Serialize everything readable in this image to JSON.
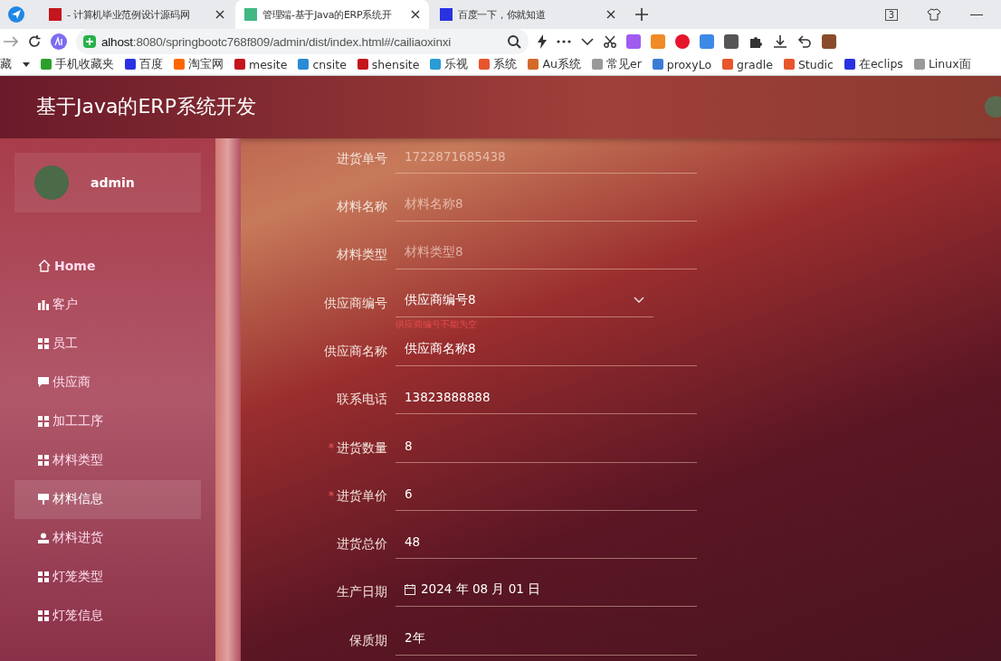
{
  "browser": {
    "tabs": [
      {
        "title": "- 计算机毕业范例设计源码网",
        "selected": false
      },
      {
        "title": "管理端-基于Java的ERP系统开",
        "selected": true
      },
      {
        "title": "百度一下，你就知道",
        "selected": false
      }
    ],
    "tab_count": "3",
    "address": {
      "host": "alhost",
      "rest": ":8080/springbootc768f809/admin/dist/index.html#/cailiaoxinxi"
    },
    "bookmarks_lead": "藏",
    "bookmarks": [
      "手机收藏夹",
      "百度",
      "淘宝网",
      "mesite",
      "cnsite",
      "shensite",
      "乐视",
      "系统",
      "Au系统",
      "常见er",
      "proxyLo",
      "gradle",
      "Studic",
      "在eclips",
      "Linux面"
    ]
  },
  "app": {
    "title": "基于Java的ERP系统开发",
    "user": {
      "name": "admin"
    },
    "menu": [
      {
        "label": "Home",
        "kind": "home",
        "selected": false
      },
      {
        "label": "客户",
        "kind": "chart",
        "selected": false
      },
      {
        "label": "员工",
        "kind": "grid",
        "selected": false
      },
      {
        "label": "供应商",
        "kind": "chat",
        "selected": false
      },
      {
        "label": "加工工序",
        "kind": "grid",
        "selected": false
      },
      {
        "label": "材料类型",
        "kind": "grid",
        "selected": false
      },
      {
        "label": "材料信息",
        "kind": "pin",
        "selected": true
      },
      {
        "label": "材料进货",
        "kind": "person",
        "selected": false
      },
      {
        "label": "灯笼类型",
        "kind": "grid",
        "selected": false
      },
      {
        "label": "灯笼信息",
        "kind": "grid",
        "selected": false
      }
    ],
    "form": [
      {
        "label": "进货单号",
        "value": "1722871685438",
        "kind": "input",
        "disabled": true,
        "required": false
      },
      {
        "label": "材料名称",
        "value": "材料名称8",
        "kind": "input",
        "disabled": true,
        "required": false
      },
      {
        "label": "材料类型",
        "value": "材料类型8",
        "kind": "input",
        "disabled": true,
        "required": false
      },
      {
        "label": "供应商编号",
        "value": "供应商编号8",
        "kind": "select",
        "disabled": false,
        "required": false,
        "error": "供应商编号不能为空"
      },
      {
        "label": "供应商名称",
        "value": "供应商名称8",
        "kind": "input",
        "disabled": false,
        "required": false
      },
      {
        "label": "联系电话",
        "value": "13823888888",
        "kind": "input",
        "disabled": false,
        "required": false
      },
      {
        "label": "进货数量",
        "value": "8",
        "kind": "input",
        "disabled": false,
        "required": true
      },
      {
        "label": "进货单价",
        "value": "6",
        "kind": "input",
        "disabled": false,
        "required": true
      },
      {
        "label": "进货总价",
        "value": "48",
        "kind": "input",
        "disabled": false,
        "required": false
      },
      {
        "label": "生产日期",
        "value": "2024 年 08 月 01 日",
        "kind": "date",
        "disabled": false,
        "required": false
      },
      {
        "label": "保质期",
        "value": "2年",
        "kind": "input",
        "disabled": false,
        "required": false
      }
    ]
  }
}
